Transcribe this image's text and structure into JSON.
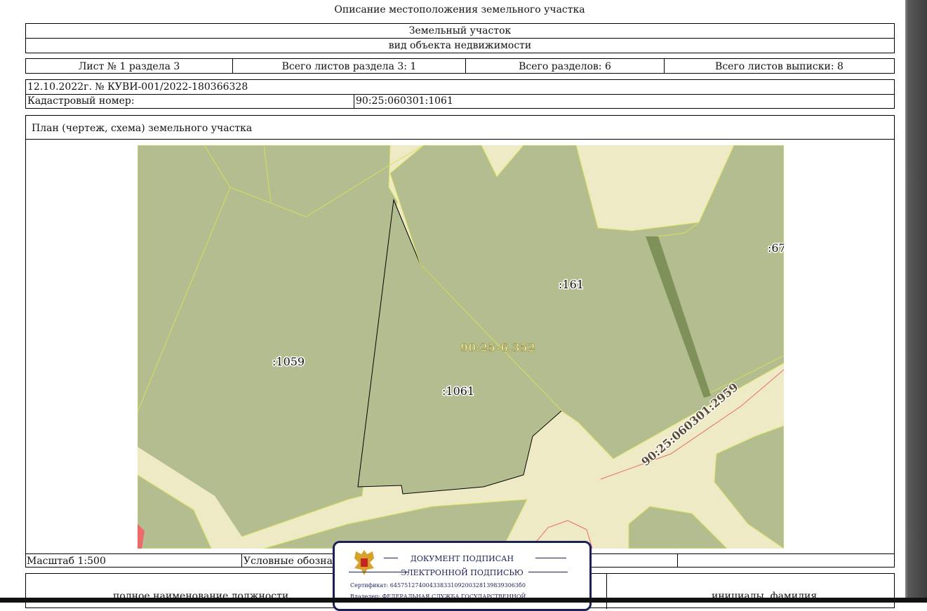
{
  "document": {
    "title": "Описание местоположения земельного участка",
    "object_name": "Земельный участок",
    "object_type_caption": "вид объекта недвижимости"
  },
  "sheet_info": {
    "sheet": "Лист № 1 раздела 3",
    "total_sheets_section": "Всего листов раздела 3: 1",
    "total_sections": "Всего разделов: 6",
    "total_sheets_extract": "Всего листов выписки: 8"
  },
  "extract": {
    "date_number": "12.10.2022г. № КУВИ-001/2022-180366328",
    "cadastral_label": "Кадастровый номер:",
    "cadastral_number": "90:25:060301:1061"
  },
  "plan": {
    "heading": "План (чертеж, схема) земельного участка",
    "labels": {
      "parcel_1059": ":1059",
      "parcel_1061": ":1061",
      "parcel_161": ":161",
      "parcel_67": ":67",
      "quarter": "90:25-6.352",
      "road": "90:25:060301:2959"
    },
    "colors": {
      "parcel_fill": "#b3bd8f",
      "background_fill": "#efeac6",
      "boundary_line": "#d7e05a",
      "strip_fill": "#7e9158",
      "red_line": "#e36b6b"
    }
  },
  "footer": {
    "scale": "Масштаб 1:500",
    "legend": "Условные обозначения:",
    "position_caption": "полное наименование должности",
    "initials_caption": "инициалы, фамилия"
  },
  "signature_stamp": {
    "line1": "ДОКУМЕНТ ПОДПИСАН",
    "line2": "ЭЛЕКТРОННОЙ ПОДПИСЬЮ",
    "certificate": "Сертификат: 645751274004338331092003281398393063б0",
    "owner": "Владелец: ФЕДЕРАЛЬНАЯ СЛУЖБА ГОСУДАРСТВЕННОЙ"
  }
}
